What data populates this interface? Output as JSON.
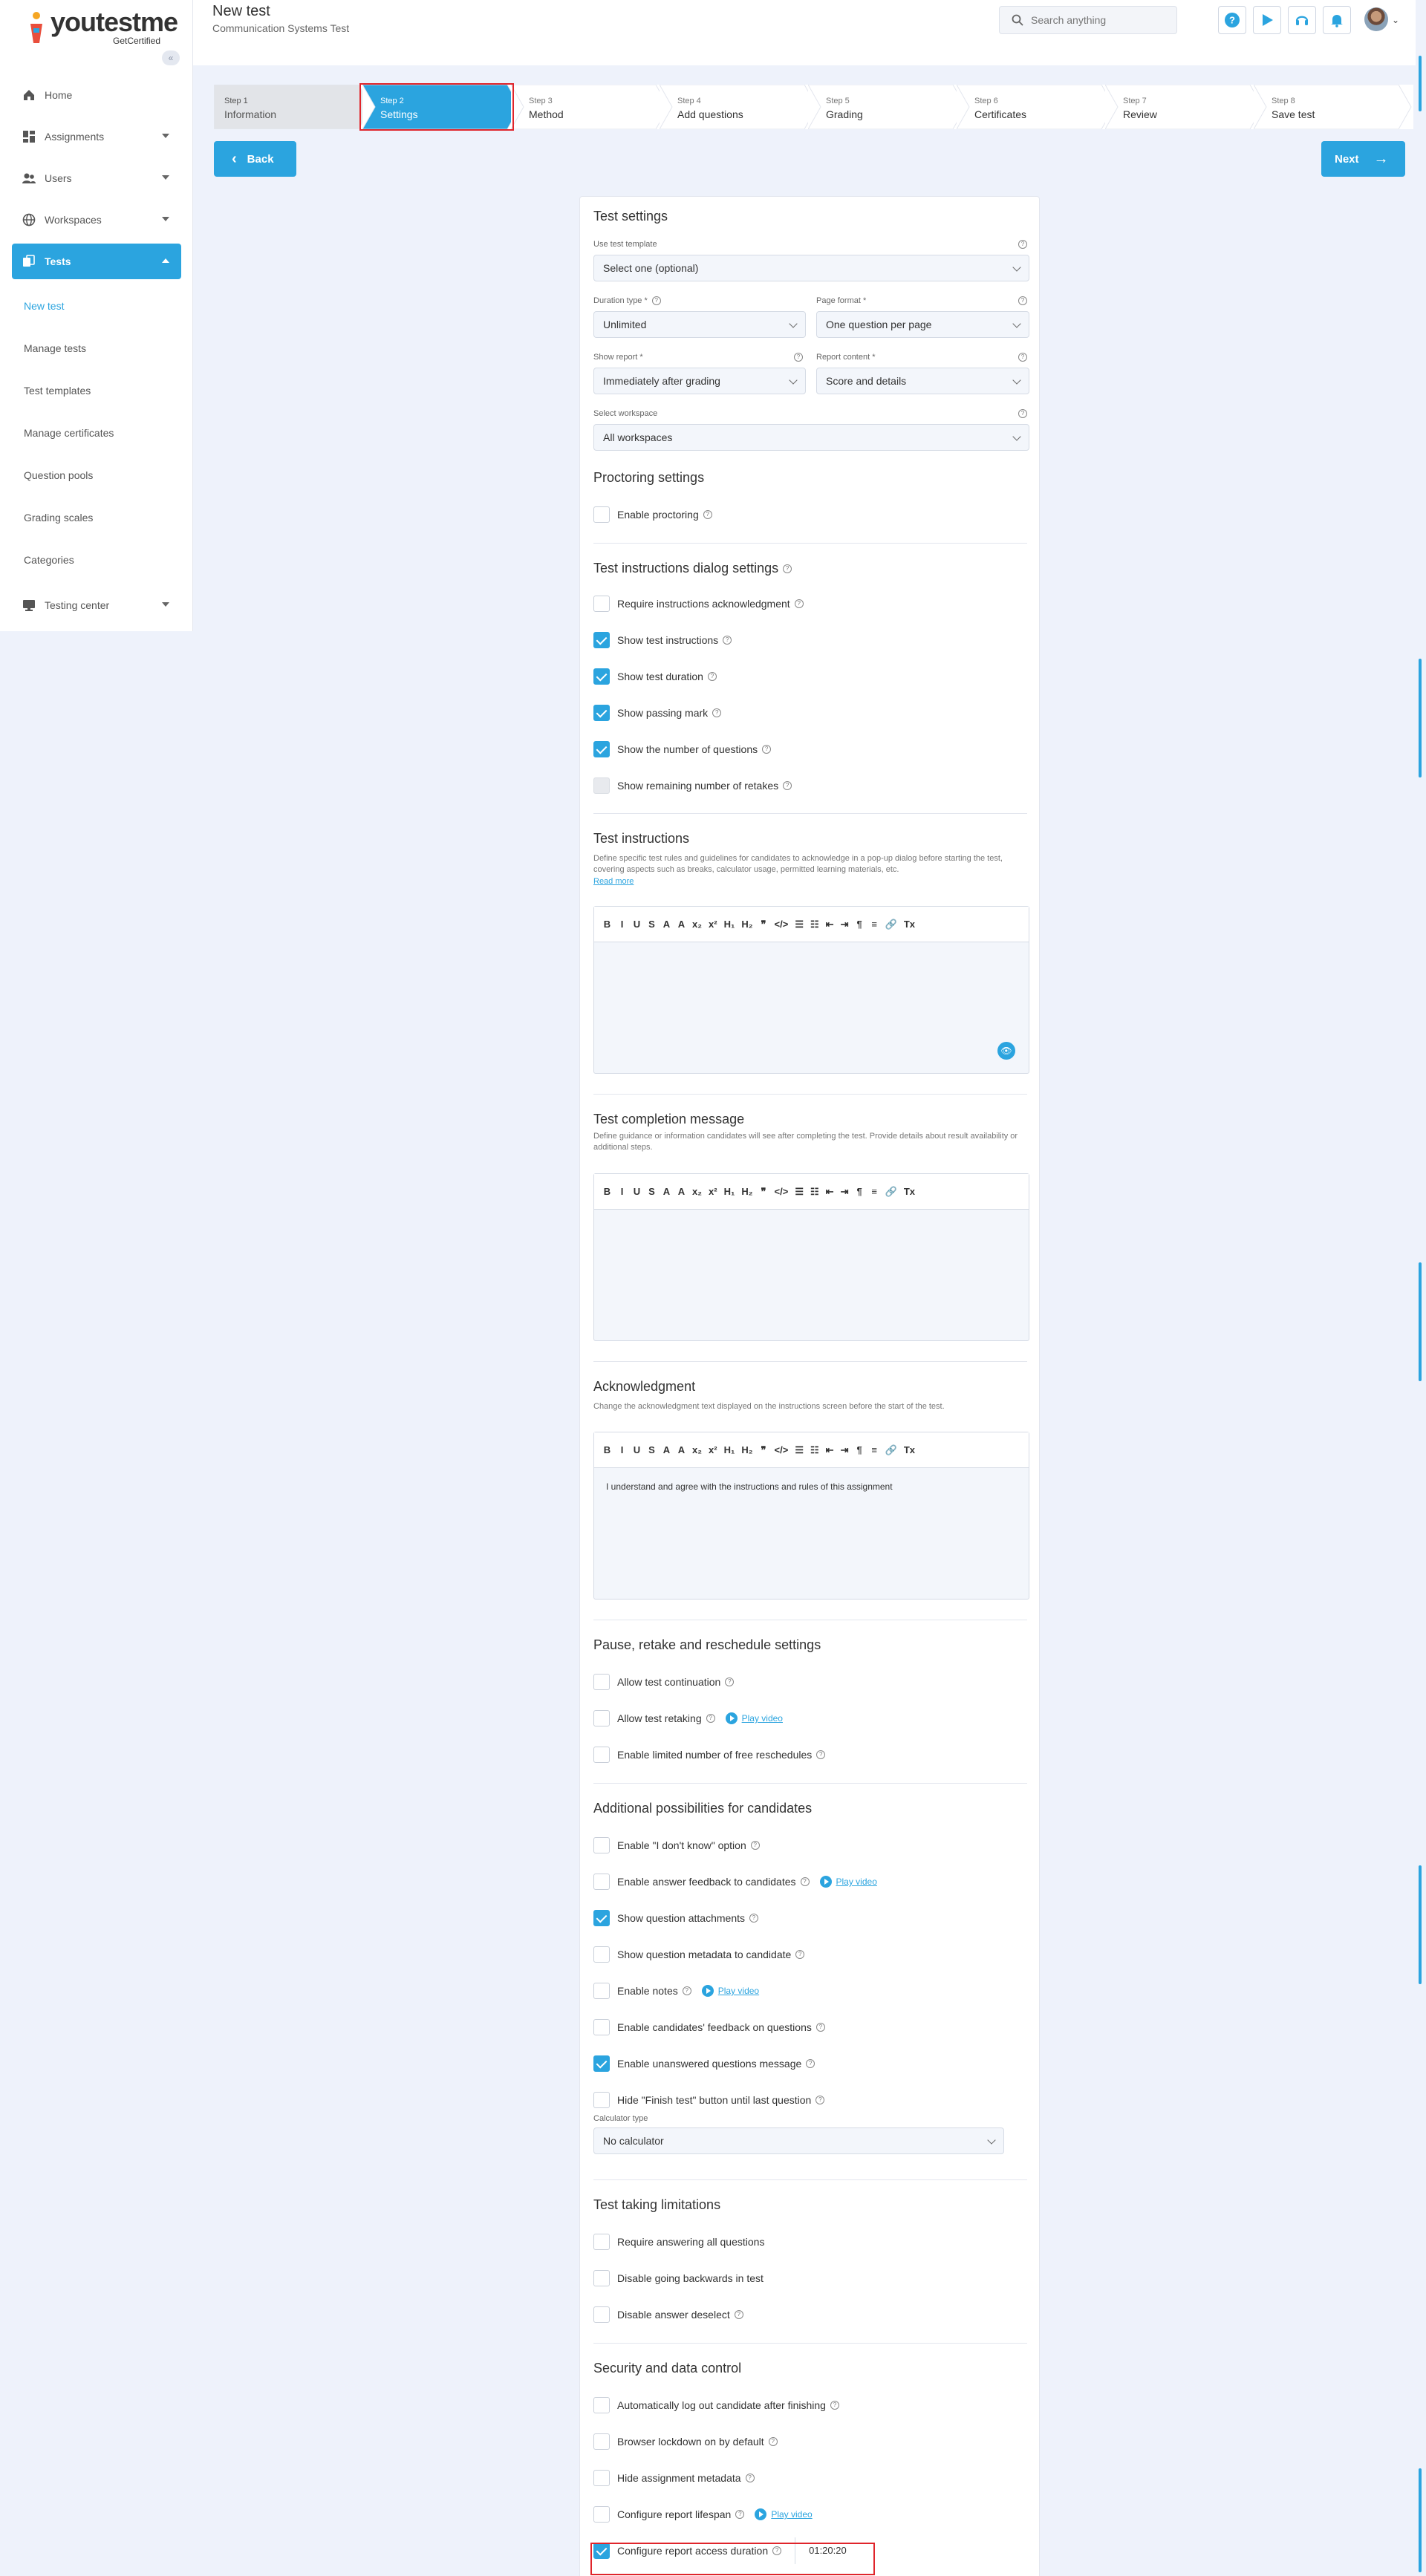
{
  "brand": {
    "name": "youtestme",
    "sub": "GetCertified"
  },
  "sidebar": {
    "collapse_icon": "double-chevron-left-icon",
    "items": [
      {
        "label": "Home",
        "icon": "home-icon",
        "has_caret": false
      },
      {
        "label": "Assignments",
        "icon": "dashboard-icon",
        "has_caret": true
      },
      {
        "label": "Users",
        "icon": "users-icon",
        "has_caret": true
      },
      {
        "label": "Workspaces",
        "icon": "globe-icon",
        "has_caret": true
      },
      {
        "label": "Tests",
        "icon": "copy-icon",
        "has_caret": true,
        "active": true
      }
    ],
    "sub_items": [
      "New test",
      "Manage tests",
      "Test templates",
      "Manage certificates",
      "Question pools",
      "Grading scales",
      "Categories"
    ],
    "testing_center": {
      "label": "Testing center",
      "icon": "monitor-icon"
    }
  },
  "header": {
    "title": "New test",
    "subtitle": "Communication Systems Test",
    "search_placeholder": "Search anything"
  },
  "stepper": [
    {
      "n": "Step 1",
      "label": "Information",
      "state": "done"
    },
    {
      "n": "Step 2",
      "label": "Settings",
      "state": "active"
    },
    {
      "n": "Step 3",
      "label": "Method",
      "state": "todo"
    },
    {
      "n": "Step 4",
      "label": "Add questions",
      "state": "todo"
    },
    {
      "n": "Step 5",
      "label": "Grading",
      "state": "todo"
    },
    {
      "n": "Step 6",
      "label": "Certificates",
      "state": "todo"
    },
    {
      "n": "Step 7",
      "label": "Review",
      "state": "todo"
    },
    {
      "n": "Step 8",
      "label": "Save test",
      "state": "todo"
    }
  ],
  "nav_buttons": {
    "back": "Back",
    "next": "Next"
  },
  "test_settings": {
    "title": "Test settings",
    "template_label": "Use test template",
    "template_value": "Select one (optional)",
    "duration_label": "Duration type *",
    "duration_value": "Unlimited",
    "page_format_label": "Page format *",
    "page_format_value": "One question per page",
    "show_report_label": "Show report *",
    "show_report_value": "Immediately after grading",
    "report_content_label": "Report content *",
    "report_content_value": "Score and details",
    "workspace_label": "Select workspace",
    "workspace_value": "All workspaces"
  },
  "proctoring": {
    "title": "Proctoring settings",
    "enable": "Enable proctoring"
  },
  "instructions_dialog": {
    "title": "Test instructions dialog settings",
    "items": [
      {
        "label": "Require instructions acknowledgment",
        "checked": false
      },
      {
        "label": "Show test instructions",
        "checked": true
      },
      {
        "label": "Show test duration",
        "checked": true
      },
      {
        "label": "Show passing mark",
        "checked": true
      },
      {
        "label": "Show the number of questions",
        "checked": true
      },
      {
        "label": "Show remaining number of retakes",
        "checked": false,
        "disabled": true
      }
    ]
  },
  "test_instructions": {
    "title": "Test instructions",
    "desc": "Define specific test rules and guidelines for candidates to acknowledge in a pop-up dialog before starting the test, covering aspects such as breaks, calculator usage, permitted learning materials, etc.",
    "read_more": "Read more"
  },
  "toolbar_glyphs": [
    "B",
    "I",
    "U",
    "S",
    "A",
    "A",
    "x₂",
    "x²",
    "H₁",
    "H₂",
    "❞",
    "</>",
    "☰",
    "☷",
    "⇤",
    "⇥",
    "¶",
    "≡",
    "🔗",
    "Tx"
  ],
  "completion_message": {
    "title": "Test completion message",
    "desc": "Define guidance or information candidates will see after completing the test. Provide details about result availability or additional steps."
  },
  "acknowledgment": {
    "title": "Acknowledgment",
    "desc": "Change the acknowledgment text displayed on the instructions screen before the start of the test.",
    "text": "I understand and agree with the instructions and rules of this assignment"
  },
  "pause_retake": {
    "title": "Pause, retake and reschedule settings",
    "items": [
      {
        "label": "Allow test continuation",
        "checked": false,
        "video": false
      },
      {
        "label": "Allow test retaking",
        "checked": false,
        "video": true
      },
      {
        "label": "Enable limited number of free reschedules",
        "checked": false,
        "video": false
      }
    ]
  },
  "play_video": "Play video",
  "additional": {
    "title": "Additional possibilities for candidates",
    "items": [
      {
        "label": "Enable \"I don't know\" option",
        "checked": false,
        "video": false
      },
      {
        "label": "Enable answer feedback to candidates",
        "checked": false,
        "video": true
      },
      {
        "label": "Show question attachments",
        "checked": true,
        "video": false
      },
      {
        "label": "Show question metadata to candidate",
        "checked": false,
        "video": false
      },
      {
        "label": "Enable notes",
        "checked": false,
        "video": true
      },
      {
        "label": "Enable candidates' feedback on questions",
        "checked": false,
        "video": false
      },
      {
        "label": "Enable unanswered questions message",
        "checked": true,
        "video": false
      },
      {
        "label": "Hide \"Finish test\" button until last question",
        "checked": false,
        "video": false
      }
    ],
    "calculator_label": "Calculator type",
    "calculator_value": "No calculator"
  },
  "limitations": {
    "title": "Test taking limitations",
    "items": [
      {
        "label": "Require answering all questions",
        "checked": false
      },
      {
        "label": "Disable going backwards in test",
        "checked": false
      },
      {
        "label": "Disable answer deselect",
        "checked": false
      }
    ]
  },
  "security": {
    "title": "Security and data control",
    "items": [
      {
        "label": "Automatically log out candidate after finishing",
        "checked": false,
        "video": false
      },
      {
        "label": "Browser lockdown on by default",
        "checked": false,
        "video": false
      },
      {
        "label": "Hide assignment metadata",
        "checked": false,
        "video": false
      },
      {
        "label": "Configure report lifespan",
        "checked": false,
        "video": true
      },
      {
        "label": "Configure report access duration",
        "checked": true,
        "video": false
      }
    ],
    "access_duration": "01:20:20"
  },
  "colors": {
    "accent": "#2ba4df",
    "highlight": "#e0252b"
  }
}
